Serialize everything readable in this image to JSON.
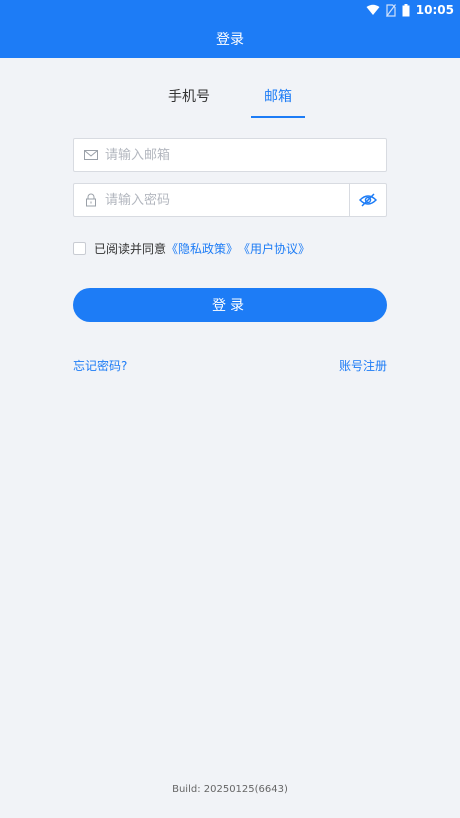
{
  "status_bar": {
    "time": "10:05",
    "icons": [
      "wifi-icon",
      "no-sim-icon",
      "battery-icon"
    ]
  },
  "header": {
    "title": "登录"
  },
  "tabs": [
    {
      "label": "手机号",
      "active": false
    },
    {
      "label": "邮箱",
      "active": true
    }
  ],
  "form": {
    "email_placeholder": "请输入邮箱",
    "email_value": "",
    "password_placeholder": "请输入密码",
    "password_value": ""
  },
  "agreement": {
    "prefix": "已阅读并同意",
    "privacy_link": "《隐私政策》",
    "user_link": "《用户协议》",
    "checked": false
  },
  "login_label": "登录",
  "links": {
    "forgot": "忘记密码?",
    "register": "账号注册"
  },
  "build_info": "Build: 20250125(6643)",
  "colors": {
    "accent": "#1d7cf6",
    "background": "#f1f3f7"
  }
}
